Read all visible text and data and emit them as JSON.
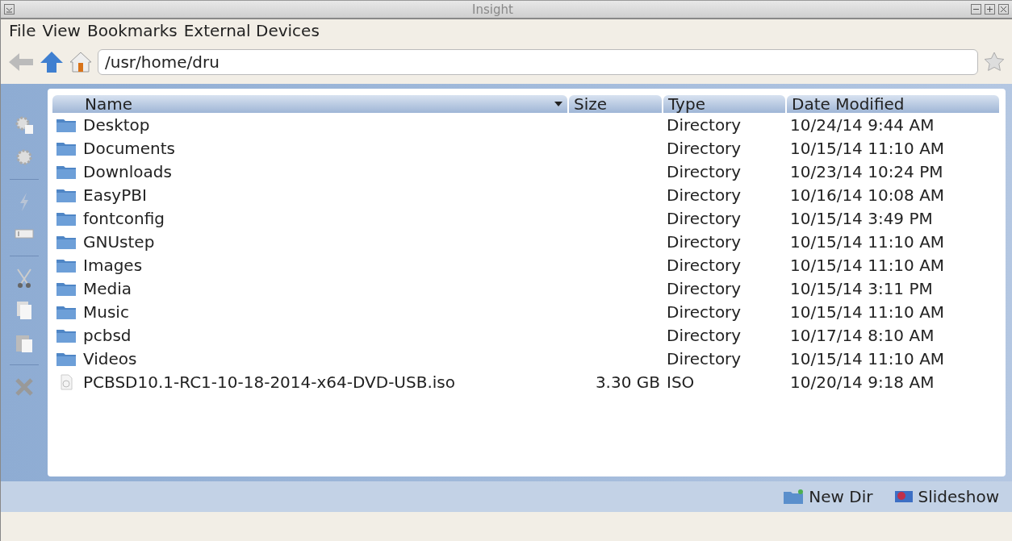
{
  "window": {
    "title": "Insight"
  },
  "menu": [
    "File",
    "View",
    "Bookmarks",
    "External Devices"
  ],
  "address": {
    "value": "/usr/home/dru"
  },
  "table": {
    "columns": [
      {
        "label": "Name",
        "sorted": true
      },
      {
        "label": "Size",
        "sorted": false
      },
      {
        "label": "Type",
        "sorted": false
      },
      {
        "label": "Date Modified",
        "sorted": false
      }
    ],
    "rows": [
      {
        "kind": "folder",
        "name": "Desktop",
        "type": "Directory",
        "date": "10/24/14 9:44 AM"
      },
      {
        "kind": "folder",
        "name": "Documents",
        "type": "Directory",
        "date": "10/15/14 11:10 AM"
      },
      {
        "kind": "folder",
        "name": "Downloads",
        "type": "Directory",
        "date": "10/23/14 10:24 PM"
      },
      {
        "kind": "folder",
        "name": "EasyPBI",
        "type": "Directory",
        "date": "10/16/14 10:08 AM"
      },
      {
        "kind": "folder",
        "name": "fontconfig",
        "type": "Directory",
        "date": "10/15/14 3:49 PM"
      },
      {
        "kind": "folder",
        "name": "GNUstep",
        "type": "Directory",
        "date": "10/15/14 11:10 AM"
      },
      {
        "kind": "folder",
        "name": "Images",
        "type": "Directory",
        "date": "10/15/14 11:10 AM"
      },
      {
        "kind": "folder",
        "name": "Media",
        "type": "Directory",
        "date": "10/15/14 3:11 PM"
      },
      {
        "kind": "folder",
        "name": "Music",
        "type": "Directory",
        "date": "10/15/14 11:10 AM"
      },
      {
        "kind": "folder",
        "name": "pcbsd",
        "type": "Directory",
        "date": "10/17/14 8:10 AM"
      },
      {
        "kind": "folder",
        "name": "Videos",
        "type": "Directory",
        "date": "10/15/14 11:10 AM"
      },
      {
        "kind": "file",
        "name": "PCBSD10.1-RC1-10-18-2014-x64-DVD-USB.iso",
        "size": "3.30 GB",
        "type": "ISO",
        "date": "10/20/14 9:18 AM"
      }
    ]
  },
  "actions": [
    {
      "kind": "newdir",
      "label": "New Dir"
    },
    {
      "kind": "slideshow",
      "label": "Slideshow"
    }
  ]
}
